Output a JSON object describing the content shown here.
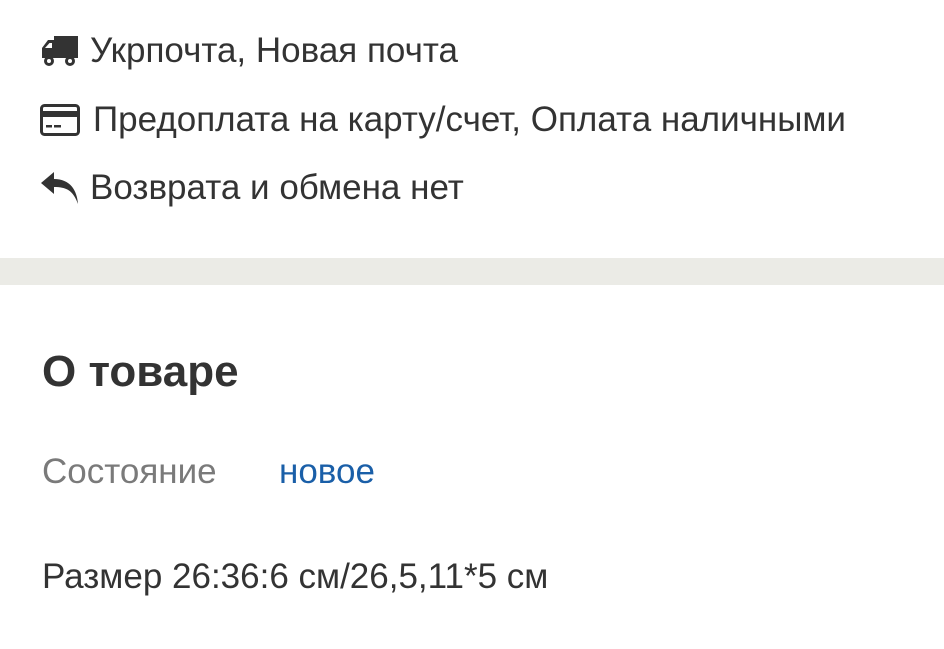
{
  "shipping": {
    "icon": "truck-icon",
    "text": "Укрпочта, Новая почта"
  },
  "payment": {
    "icon": "credit-card-icon",
    "text": "Предоплата на карту/счет, Оплата наличными"
  },
  "returns": {
    "icon": "reply-arrow-icon",
    "text": "Возврата и обмена нет"
  },
  "about": {
    "title": "О товаре",
    "condition_label": "Состояние",
    "condition_value": "новое",
    "description": "Размер 26:36:6 см/26,5,11*5 см"
  },
  "colors": {
    "text": "#333333",
    "muted": "#7a7a7a",
    "link": "#1a5fa8",
    "divider": "#ebebe6"
  }
}
